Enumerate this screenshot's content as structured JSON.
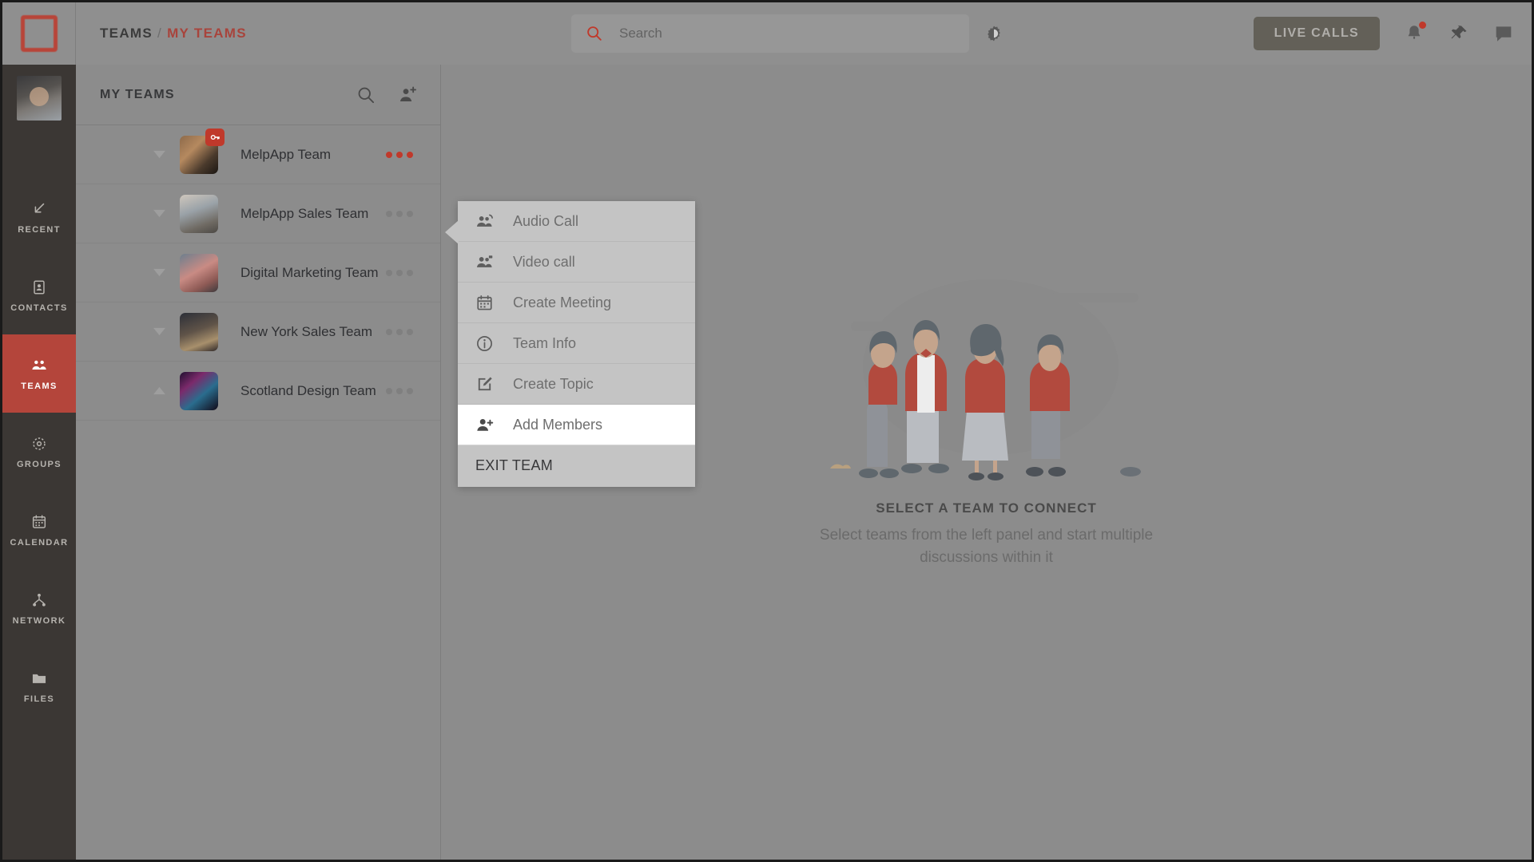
{
  "header": {
    "logo_icon": "app-logo-square",
    "breadcrumb": {
      "root": "TEAMS",
      "separator": "/",
      "current": "MY TEAMS"
    },
    "search": {
      "placeholder": "Search",
      "value": "",
      "icon": "search-icon"
    },
    "theme_toggle_icon": "brightness-contrast-icon",
    "live_calls_label": "LIVE CALLS",
    "notifications_icon": "bell-icon",
    "notifications_has_badge": true,
    "pin_icon": "pin-icon",
    "chat_icon": "chat-bubble-icon",
    "accent_color": "#c0392b"
  },
  "rail": {
    "avatar_name": "user-avatar",
    "items": [
      {
        "label": "RECENT",
        "icon": "arrow-down-left-icon",
        "active": false
      },
      {
        "label": "CONTACTS",
        "icon": "contact-card-icon",
        "active": false
      },
      {
        "label": "TEAMS",
        "icon": "people-group-icon",
        "active": true
      },
      {
        "label": "GROUPS",
        "icon": "group-circle-icon",
        "active": false
      },
      {
        "label": "CALENDAR",
        "icon": "calendar-icon",
        "active": false
      },
      {
        "label": "NETWORK",
        "icon": "network-nodes-icon",
        "active": false
      },
      {
        "label": "FILES",
        "icon": "folder-icon",
        "active": false
      }
    ],
    "active_color": "#b4453b",
    "background_color": "#3b3734"
  },
  "panel": {
    "title": "MY TEAMS",
    "search_icon": "search-icon",
    "add_member_icon": "add-people-icon",
    "teams": [
      {
        "name": "MelpApp Team",
        "expanded": false,
        "locked": true,
        "lock_icon": "key-icon",
        "menu_icon": "more-options-icon",
        "menu_active": true
      },
      {
        "name": "MelpApp Sales Team",
        "expanded": false,
        "locked": false,
        "lock_icon": "",
        "menu_icon": "more-options-icon",
        "menu_active": false
      },
      {
        "name": "Digital Marketing Team",
        "expanded": false,
        "locked": false,
        "lock_icon": "",
        "menu_icon": "more-options-icon",
        "menu_active": false
      },
      {
        "name": "New York Sales Team",
        "expanded": false,
        "locked": false,
        "lock_icon": "",
        "menu_icon": "more-options-icon",
        "menu_active": false
      },
      {
        "name": "Scotland Design Team",
        "expanded": true,
        "locked": false,
        "lock_icon": "",
        "menu_icon": "more-options-icon",
        "menu_active": false
      }
    ]
  },
  "context_menu": {
    "anchor_team": "MelpApp Sales Team",
    "items": [
      {
        "label": "Audio Call",
        "icon": "audio-call-icon",
        "selected": false
      },
      {
        "label": "Video call",
        "icon": "video-call-icon",
        "selected": false
      },
      {
        "label": "Create Meeting",
        "icon": "calendar-icon",
        "selected": false
      },
      {
        "label": "Team Info",
        "icon": "info-circle-icon",
        "selected": false
      },
      {
        "label": "Create Topic",
        "icon": "edit-square-icon",
        "selected": false
      },
      {
        "label": "Add Members",
        "icon": "add-person-icon",
        "selected": true
      }
    ],
    "exit_label": "EXIT TEAM"
  },
  "empty_state": {
    "illustration": "four-people-illustration",
    "title": "SELECT A TEAM TO CONNECT",
    "subtitle": "Select teams from the left panel and start multiple discussions within it"
  }
}
